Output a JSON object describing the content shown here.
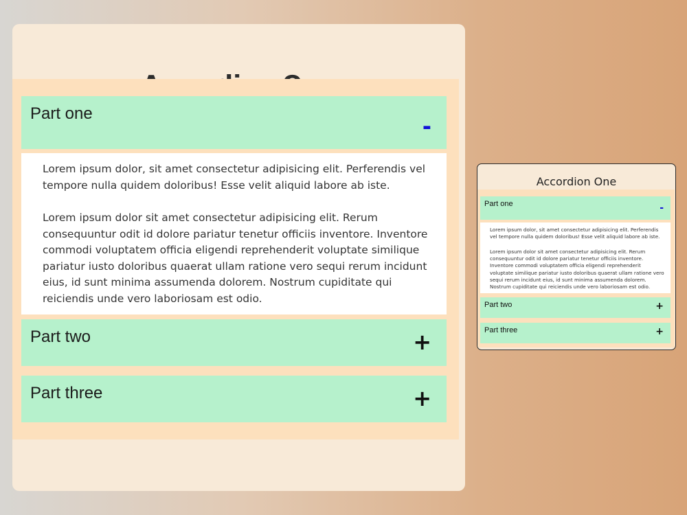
{
  "title": "Accordion One",
  "items": [
    {
      "label": "Part one",
      "sign": "-",
      "expanded": true
    },
    {
      "label": "Part two",
      "sign": "+",
      "expanded": false
    },
    {
      "label": "Part three",
      "sign": "+",
      "expanded": false
    }
  ],
  "content": {
    "paragraph1": "Lorem ipsum dolor, sit amet consectetur adipisicing elit. Perferendis vel tempore nulla quidem doloribus! Esse velit aliquid labore ab iste.",
    "paragraph2": "Lorem ipsum dolor sit amet consectetur adipisicing elit. Rerum consequuntur odit id dolore pariatur tenetur officiis inventore. Inventore commodi voluptatem officia eligendi reprehenderit voluptate similique pariatur iusto doloribus quaerat ullam ratione vero sequi rerum incidunt eius, id sunt minima assumenda dolorem. Nostrum cupiditate qui reiciendis unde vero laboriosam est odio."
  },
  "colors": {
    "header_bg": "#b6f1cc",
    "panel_bg": "#fde0bd",
    "card_bg": "#f8ead8",
    "minus_color": "#1010d8"
  }
}
